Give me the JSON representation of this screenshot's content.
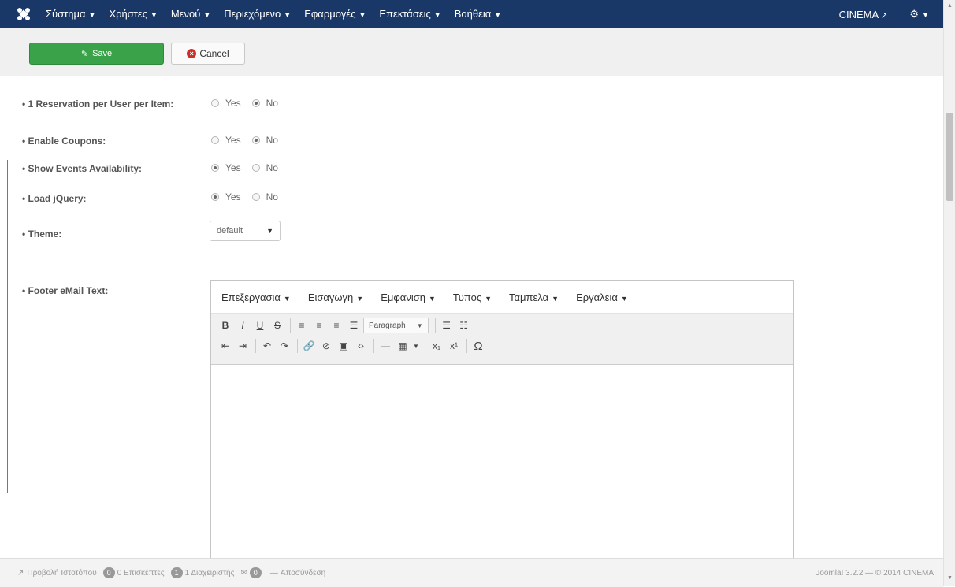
{
  "navbar": {
    "logo_icon": "joomla-icon",
    "menu": [
      {
        "label": "Σύστημα"
      },
      {
        "label": "Χρήστες"
      },
      {
        "label": "Μενού"
      },
      {
        "label": "Περιεχόμενο"
      },
      {
        "label": "Εφαρμογές"
      },
      {
        "label": "Επεκτάσεις"
      },
      {
        "label": "Βοήθεια"
      }
    ],
    "site_label": "CINEMA",
    "site_icon": "external-link-icon",
    "settings_icon": "gear-icon"
  },
  "toolbar": {
    "save_label": "Save",
    "cancel_label": "Cancel"
  },
  "form": {
    "fields": [
      {
        "label": "• 1 Reservation per User per Item:",
        "type": "radio",
        "options": [
          "Yes",
          "No"
        ],
        "selected": "No"
      },
      {
        "label": "• Enable Coupons:",
        "type": "radio",
        "options": [
          "Yes",
          "No"
        ],
        "selected": "No"
      },
      {
        "label": "• Show Events Availability:",
        "type": "radio",
        "options": [
          "Yes",
          "No"
        ],
        "selected": "Yes"
      },
      {
        "label": "• Load jQuery:",
        "type": "radio",
        "options": [
          "Yes",
          "No"
        ],
        "selected": "Yes"
      },
      {
        "label": "• Theme:",
        "type": "select",
        "value": "default"
      },
      {
        "label": "• Footer eMail Text:",
        "type": "editor"
      }
    ]
  },
  "editor": {
    "menu": [
      "Επεξεργασια",
      "Εισαγωγη",
      "Εμφανιση",
      "Τυπος",
      "Ταμπελα",
      "Εργαλεια"
    ],
    "format_select": "Paragraph",
    "content": ""
  },
  "statusbar": {
    "view_site": "Προβολή Ιστοτόπου",
    "visitors_count": "0",
    "visitors_label": "0 Επισκέπτες",
    "admins_count": "1",
    "admins_label": "1 Διαχειριστής",
    "messages_count": "0",
    "logout_label": "Αποσύνδεση",
    "version": "Joomla! 3.2.2 — © 2014 CINEMA"
  }
}
